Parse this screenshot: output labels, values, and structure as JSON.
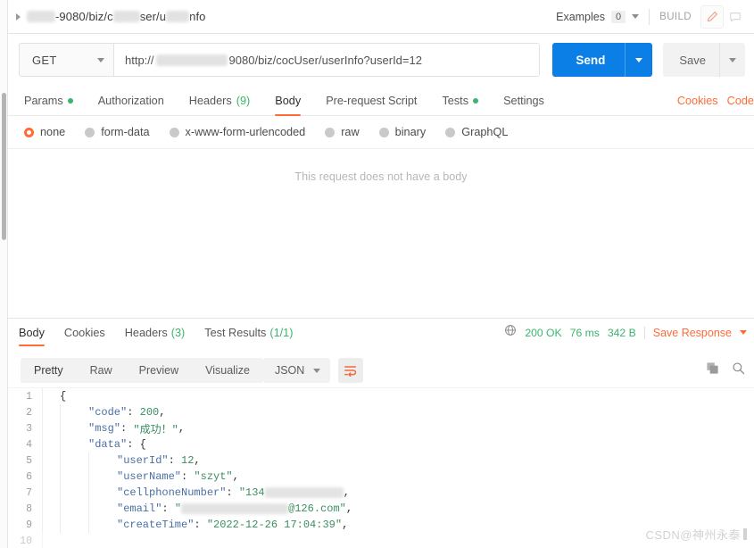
{
  "tab_header": {
    "title_prefix": "-9080/biz/c",
    "title_mid": "ser/u",
    "title_suffix": "nfo",
    "expand_icon": "caret-right-icon",
    "examples_label": "Examples",
    "examples_count": "0",
    "build_label": "BUILD",
    "edit_icon": "pencil-icon",
    "comment_icon": "comment-icon"
  },
  "request": {
    "method": "GET",
    "url_prefix": "http://",
    "url_suffix": "9080/biz/cocUser/userInfo?userId=12",
    "send_label": "Send",
    "save_label": "Save",
    "tabs": [
      {
        "label": "Params",
        "dot": true,
        "count": "",
        "active": false
      },
      {
        "label": "Authorization",
        "dot": false,
        "count": "",
        "active": false
      },
      {
        "label": "Headers",
        "dot": false,
        "count": "(9)",
        "active": false
      },
      {
        "label": "Body",
        "dot": false,
        "count": "",
        "active": true
      },
      {
        "label": "Pre-request Script",
        "dot": false,
        "count": "",
        "active": false
      },
      {
        "label": "Tests",
        "dot": true,
        "count": "",
        "active": false
      },
      {
        "label": "Settings",
        "dot": false,
        "count": "",
        "active": false
      }
    ],
    "right_links": [
      {
        "label": "Cookies"
      },
      {
        "label": "Code"
      }
    ],
    "body_types": [
      {
        "label": "none",
        "selected": true
      },
      {
        "label": "form-data",
        "selected": false
      },
      {
        "label": "x-www-form-urlencoded",
        "selected": false
      },
      {
        "label": "raw",
        "selected": false
      },
      {
        "label": "binary",
        "selected": false
      },
      {
        "label": "GraphQL",
        "selected": false
      }
    ],
    "empty_body_text": "This request does not have a body"
  },
  "response": {
    "tabs": [
      {
        "label": "Body",
        "count": "",
        "active": true
      },
      {
        "label": "Cookies",
        "count": "",
        "active": false
      },
      {
        "label": "Headers",
        "count": "(3)",
        "active": false
      },
      {
        "label": "Test Results",
        "count": "(1/1)",
        "active": false
      }
    ],
    "globe_icon": "globe-icon",
    "status": "200 OK",
    "time": "76 ms",
    "size": "342 B",
    "save_response_label": "Save Response",
    "toolbar": {
      "views": [
        {
          "label": "Pretty",
          "active": true
        },
        {
          "label": "Raw",
          "active": false
        },
        {
          "label": "Preview",
          "active": false
        },
        {
          "label": "Visualize",
          "active": false
        }
      ],
      "format": "JSON",
      "wrap_icon": "wrap-text-icon",
      "copy_icon": "copy-icon",
      "search_icon": "search-icon"
    },
    "body_lines": [
      {
        "num": "1",
        "indent": 0,
        "tokens": [
          {
            "t": "brace",
            "v": "{"
          }
        ]
      },
      {
        "num": "2",
        "indent": 1,
        "tokens": [
          {
            "t": "k",
            "v": "\"code\""
          },
          {
            "t": "p",
            "v": ": "
          },
          {
            "t": "n",
            "v": "200"
          },
          {
            "t": "p",
            "v": ","
          }
        ]
      },
      {
        "num": "3",
        "indent": 1,
        "tokens": [
          {
            "t": "k",
            "v": "\"msg\""
          },
          {
            "t": "p",
            "v": ": "
          },
          {
            "t": "s",
            "v": "\"成功！\""
          },
          {
            "t": "p",
            "v": ","
          }
        ]
      },
      {
        "num": "4",
        "indent": 1,
        "tokens": [
          {
            "t": "k",
            "v": "\"data\""
          },
          {
            "t": "p",
            "v": ": "
          },
          {
            "t": "brace",
            "v": "{"
          }
        ]
      },
      {
        "num": "5",
        "indent": 2,
        "tokens": [
          {
            "t": "k",
            "v": "\"userId\""
          },
          {
            "t": "p",
            "v": ": "
          },
          {
            "t": "n",
            "v": "12"
          },
          {
            "t": "p",
            "v": ","
          }
        ]
      },
      {
        "num": "6",
        "indent": 2,
        "tokens": [
          {
            "t": "k",
            "v": "\"userName\""
          },
          {
            "t": "p",
            "v": ": "
          },
          {
            "t": "s",
            "v": "\"szyt\""
          },
          {
            "t": "p",
            "v": ","
          }
        ]
      },
      {
        "num": "7",
        "indent": 2,
        "tokens": [
          {
            "t": "k",
            "v": "\"cellphoneNumber\""
          },
          {
            "t": "p",
            "v": ": "
          },
          {
            "t": "s",
            "v": "\"134"
          },
          {
            "t": "blur",
            "v": "88"
          },
          {
            "t": "p",
            "v": ","
          }
        ]
      },
      {
        "num": "8",
        "indent": 2,
        "tokens": [
          {
            "t": "k",
            "v": "\"email\""
          },
          {
            "t": "p",
            "v": ": "
          },
          {
            "t": "s",
            "v": "\""
          },
          {
            "t": "blur",
            "v": "120"
          },
          {
            "t": "s",
            "v": "@126.com\""
          },
          {
            "t": "p",
            "v": ","
          }
        ]
      },
      {
        "num": "9",
        "indent": 2,
        "tokens": [
          {
            "t": "k",
            "v": "\"createTime\""
          },
          {
            "t": "p",
            "v": ": "
          },
          {
            "t": "s",
            "v": "\"2022-12-26 17:04:39\""
          },
          {
            "t": "p",
            "v": ","
          }
        ]
      }
    ]
  },
  "watermark": {
    "text": "CSDN@神州永泰"
  },
  "colors": {
    "accent_orange": "#ff6c37",
    "send_blue": "#0b7fe5",
    "status_green": "#3cb46e"
  }
}
